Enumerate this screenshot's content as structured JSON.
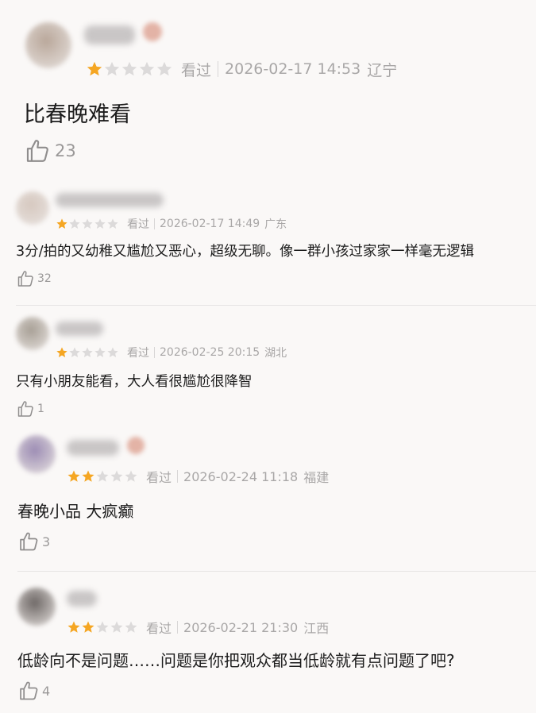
{
  "reviews": [
    {
      "stars_filled": 1,
      "stars_total": 5,
      "watched_label": "看过",
      "datetime": "2026-02-17 14:53",
      "region": "辽宁",
      "text": "比春晚难看",
      "likes": "23",
      "avatar_color": "#b9a79a"
    },
    {
      "stars_filled": 1,
      "stars_total": 5,
      "watched_label": "看过",
      "datetime": "2026-02-17 14:49",
      "region": "广东",
      "text": "3分/拍的又幼稚又尴尬又恶心，超级无聊。像一群小孩过家家一样毫无逻辑",
      "likes": "32",
      "avatar_color": "#d6c8bf"
    },
    {
      "stars_filled": 1,
      "stars_total": 5,
      "watched_label": "看过",
      "datetime": "2026-02-25 20:15",
      "region": "湖北",
      "text": "只有小朋友能看，大人看很尴尬很降智",
      "likes": "1",
      "avatar_color": "#a79f95"
    },
    {
      "stars_filled": 2,
      "stars_total": 5,
      "watched_label": "看过",
      "datetime": "2026-02-24 11:18",
      "region": "福建",
      "text": "春晚小品 大疯癫",
      "likes": "3",
      "avatar_color": "#9c8cb4"
    },
    {
      "stars_filled": 2,
      "stars_total": 5,
      "watched_label": "看过",
      "datetime": "2026-02-21 21:30",
      "region": "江西",
      "text": "低龄向不是问题……问题是你把观众都当低龄就有点问题了吧?",
      "likes": "4",
      "avatar_color": "#6e6866"
    }
  ],
  "colors": {
    "star_filled": "#f5a623",
    "star_empty": "#dcdada",
    "meta_text": "#a9a7a7",
    "content_text": "#1c1c1c",
    "like_icon": "#8f8d8d"
  },
  "icons": {
    "star": "star-icon",
    "like": "thumbs-up-icon"
  }
}
